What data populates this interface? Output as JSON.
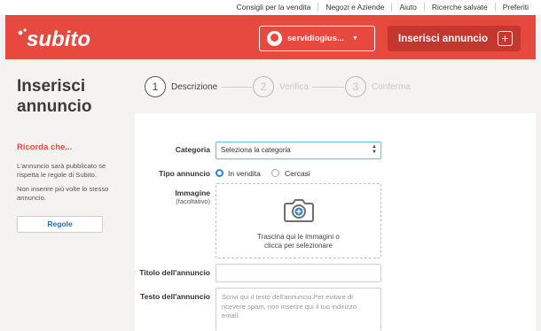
{
  "topnav": {
    "links": [
      "Consigli per la vendita",
      "Negozi e Aziende",
      "Aiuto",
      "Ricerche salvate",
      "Preferiti"
    ]
  },
  "header": {
    "logo_text": "subito",
    "user_name": "servidiogius...",
    "post_button_label": "Inserisci annuncio",
    "accent_color": "#e8493f",
    "post_button_color": "#c4372f"
  },
  "page": {
    "title": "Inserisci annuncio"
  },
  "steps": [
    {
      "number": "1",
      "label": "Descrizione",
      "active": true
    },
    {
      "number": "2",
      "label": "Verifica",
      "active": false
    },
    {
      "number": "3",
      "label": "Conferma",
      "active": false
    }
  ],
  "sidebar": {
    "heading": "Ricorda che...",
    "note_1": "L'annuncio sarà pubblicato se rispetta le regole di Subito.",
    "note_2": "Non inserire più volte lo stesso annuncio.",
    "rules_button": "Regole"
  },
  "form": {
    "category_label": "Categoria",
    "category_value": "Seleziona la categoria",
    "ad_type_label": "Tipo annuncio",
    "ad_type_options": [
      {
        "label": "In vendita",
        "selected": true
      },
      {
        "label": "Cercasi",
        "selected": false
      }
    ],
    "image_label": "Immagine",
    "image_sublabel": "(facoltativo)",
    "image_drop_line1": "Trascina qui le immagini o",
    "image_drop_line2": "clicca per selezionare",
    "title_label": "Titolo dell'annuncio",
    "title_value": "",
    "text_label": "Testo dell'annuncio",
    "text_placeholder": "Scrivi qui il testo dell'annuncio.Per evitare di ricevere spam, non inserire qui il tuo indirizzo email."
  }
}
